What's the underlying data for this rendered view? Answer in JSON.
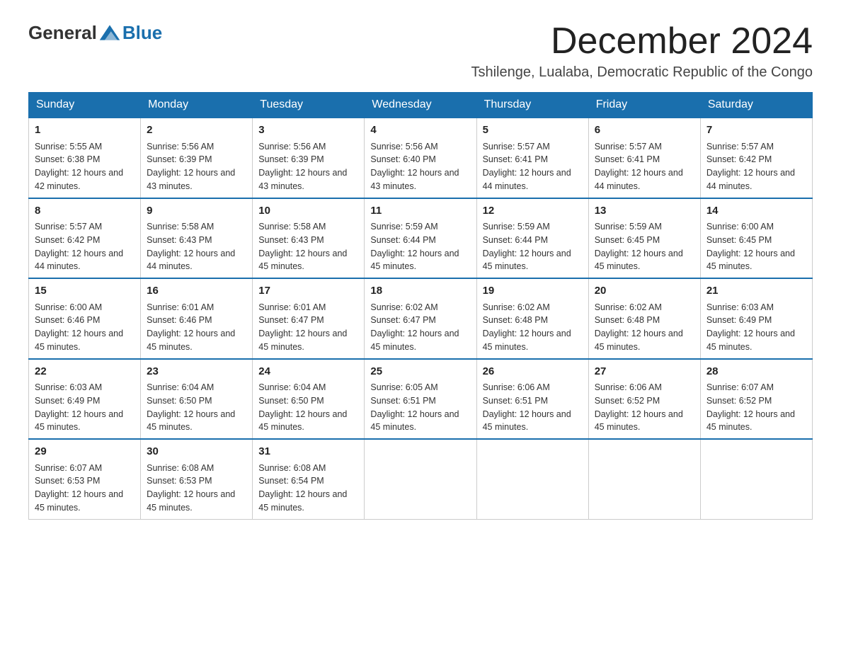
{
  "logo": {
    "text_general": "General",
    "text_blue": "Blue"
  },
  "header": {
    "month_title": "December 2024",
    "subtitle": "Tshilenge, Lualaba, Democratic Republic of the Congo"
  },
  "days_of_week": [
    "Sunday",
    "Monday",
    "Tuesday",
    "Wednesday",
    "Thursday",
    "Friday",
    "Saturday"
  ],
  "weeks": [
    [
      {
        "day": "1",
        "sunrise": "5:55 AM",
        "sunset": "6:38 PM",
        "daylight": "12 hours and 42 minutes."
      },
      {
        "day": "2",
        "sunrise": "5:56 AM",
        "sunset": "6:39 PM",
        "daylight": "12 hours and 43 minutes."
      },
      {
        "day": "3",
        "sunrise": "5:56 AM",
        "sunset": "6:39 PM",
        "daylight": "12 hours and 43 minutes."
      },
      {
        "day": "4",
        "sunrise": "5:56 AM",
        "sunset": "6:40 PM",
        "daylight": "12 hours and 43 minutes."
      },
      {
        "day": "5",
        "sunrise": "5:57 AM",
        "sunset": "6:41 PM",
        "daylight": "12 hours and 44 minutes."
      },
      {
        "day": "6",
        "sunrise": "5:57 AM",
        "sunset": "6:41 PM",
        "daylight": "12 hours and 44 minutes."
      },
      {
        "day": "7",
        "sunrise": "5:57 AM",
        "sunset": "6:42 PM",
        "daylight": "12 hours and 44 minutes."
      }
    ],
    [
      {
        "day": "8",
        "sunrise": "5:57 AM",
        "sunset": "6:42 PM",
        "daylight": "12 hours and 44 minutes."
      },
      {
        "day": "9",
        "sunrise": "5:58 AM",
        "sunset": "6:43 PM",
        "daylight": "12 hours and 44 minutes."
      },
      {
        "day": "10",
        "sunrise": "5:58 AM",
        "sunset": "6:43 PM",
        "daylight": "12 hours and 45 minutes."
      },
      {
        "day": "11",
        "sunrise": "5:59 AM",
        "sunset": "6:44 PM",
        "daylight": "12 hours and 45 minutes."
      },
      {
        "day": "12",
        "sunrise": "5:59 AM",
        "sunset": "6:44 PM",
        "daylight": "12 hours and 45 minutes."
      },
      {
        "day": "13",
        "sunrise": "5:59 AM",
        "sunset": "6:45 PM",
        "daylight": "12 hours and 45 minutes."
      },
      {
        "day": "14",
        "sunrise": "6:00 AM",
        "sunset": "6:45 PM",
        "daylight": "12 hours and 45 minutes."
      }
    ],
    [
      {
        "day": "15",
        "sunrise": "6:00 AM",
        "sunset": "6:46 PM",
        "daylight": "12 hours and 45 minutes."
      },
      {
        "day": "16",
        "sunrise": "6:01 AM",
        "sunset": "6:46 PM",
        "daylight": "12 hours and 45 minutes."
      },
      {
        "day": "17",
        "sunrise": "6:01 AM",
        "sunset": "6:47 PM",
        "daylight": "12 hours and 45 minutes."
      },
      {
        "day": "18",
        "sunrise": "6:02 AM",
        "sunset": "6:47 PM",
        "daylight": "12 hours and 45 minutes."
      },
      {
        "day": "19",
        "sunrise": "6:02 AM",
        "sunset": "6:48 PM",
        "daylight": "12 hours and 45 minutes."
      },
      {
        "day": "20",
        "sunrise": "6:02 AM",
        "sunset": "6:48 PM",
        "daylight": "12 hours and 45 minutes."
      },
      {
        "day": "21",
        "sunrise": "6:03 AM",
        "sunset": "6:49 PM",
        "daylight": "12 hours and 45 minutes."
      }
    ],
    [
      {
        "day": "22",
        "sunrise": "6:03 AM",
        "sunset": "6:49 PM",
        "daylight": "12 hours and 45 minutes."
      },
      {
        "day": "23",
        "sunrise": "6:04 AM",
        "sunset": "6:50 PM",
        "daylight": "12 hours and 45 minutes."
      },
      {
        "day": "24",
        "sunrise": "6:04 AM",
        "sunset": "6:50 PM",
        "daylight": "12 hours and 45 minutes."
      },
      {
        "day": "25",
        "sunrise": "6:05 AM",
        "sunset": "6:51 PM",
        "daylight": "12 hours and 45 minutes."
      },
      {
        "day": "26",
        "sunrise": "6:06 AM",
        "sunset": "6:51 PM",
        "daylight": "12 hours and 45 minutes."
      },
      {
        "day": "27",
        "sunrise": "6:06 AM",
        "sunset": "6:52 PM",
        "daylight": "12 hours and 45 minutes."
      },
      {
        "day": "28",
        "sunrise": "6:07 AM",
        "sunset": "6:52 PM",
        "daylight": "12 hours and 45 minutes."
      }
    ],
    [
      {
        "day": "29",
        "sunrise": "6:07 AM",
        "sunset": "6:53 PM",
        "daylight": "12 hours and 45 minutes."
      },
      {
        "day": "30",
        "sunrise": "6:08 AM",
        "sunset": "6:53 PM",
        "daylight": "12 hours and 45 minutes."
      },
      {
        "day": "31",
        "sunrise": "6:08 AM",
        "sunset": "6:54 PM",
        "daylight": "12 hours and 45 minutes."
      },
      null,
      null,
      null,
      null
    ]
  ]
}
